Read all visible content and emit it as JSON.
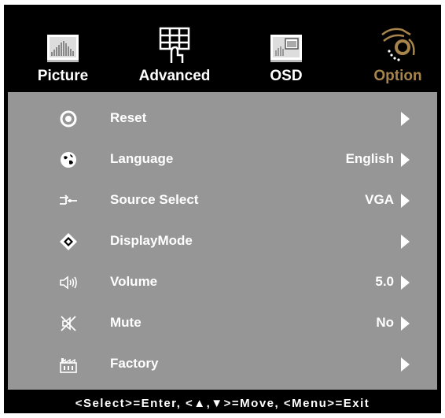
{
  "tabs": [
    {
      "label": "Picture",
      "icon": "picture-icon",
      "active": false
    },
    {
      "label": "Advanced",
      "icon": "advanced-grid-hand-icon",
      "active": false
    },
    {
      "label": "OSD",
      "icon": "osd-window-icon",
      "active": false
    },
    {
      "label": "Option",
      "icon": "option-hand-dial-icon",
      "active": true
    }
  ],
  "colors": {
    "accent": "#a8844d",
    "panel": "#969696",
    "background": "#000000",
    "text": "#ffffff"
  },
  "menu": [
    {
      "label": "Reset",
      "value": "",
      "icon": "reset-icon"
    },
    {
      "label": "Language",
      "value": "English",
      "icon": "globe-icon"
    },
    {
      "label": "Source Select",
      "value": "VGA",
      "icon": "source-select-icon"
    },
    {
      "label": "DisplayMode",
      "value": "",
      "icon": "display-mode-icon"
    },
    {
      "label": "Volume",
      "value": "5.0",
      "icon": "speaker-icon"
    },
    {
      "label": "Mute",
      "value": "No",
      "icon": "mute-icon"
    },
    {
      "label": "Factory",
      "value": "",
      "icon": "factory-icon"
    }
  ],
  "footer": "<Select>=Enter, <▲,▼>=Move, <Menu>=Exit"
}
